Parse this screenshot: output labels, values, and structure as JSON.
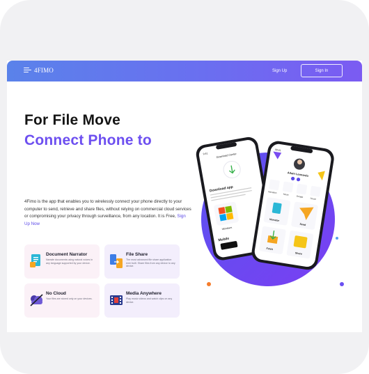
{
  "nav": {
    "brand": "4FIMO",
    "signup_label": "Sign Up",
    "signin_label": "Sign In"
  },
  "hero": {
    "line1": "For File Move",
    "line2": "Connect Phone to",
    "description": "4Fimo is the app that enables you to wirelessly connect your phone directly to your computer to send, retrieve and share files, without relying on commercial cloud services or compromising your privacy through surveillance, from any location. It is Free, ",
    "signup_link": "Sign Up Now"
  },
  "features": [
    {
      "title": "Document Narrator",
      "text": "Narrate documents using natural voices in any language supported by your device."
    },
    {
      "title": "File Share",
      "text": "The most advanced file share application ever built. Share files from any device to any device."
    },
    {
      "title": "No Cloud",
      "text": "Your files are stored only on your devices."
    },
    {
      "title": "Media Anywhere",
      "text": "Play music videos and watch clips on any device."
    }
  ],
  "phone_left": {
    "time": "9:41",
    "header": "Download Center",
    "intro": "Download app",
    "body": "4Fimo® desktop application single computer and the se everyone in the computer sign on the first time.",
    "option1": "Windows",
    "mobile": "Mobile"
  },
  "phone_right": {
    "time": "09:41",
    "user": "Adam Leonardo",
    "tiles_small": [
      "Narration",
      "Music",
      "Google",
      "Social"
    ],
    "tiles_large": [
      "Narrator",
      "Send",
      "Fetch",
      "Share"
    ]
  },
  "colors": {
    "accent": "#6d4ff0",
    "nav_start": "#5a82ea",
    "nav_end": "#7b5bf2",
    "circle": "#6a4ff2"
  }
}
